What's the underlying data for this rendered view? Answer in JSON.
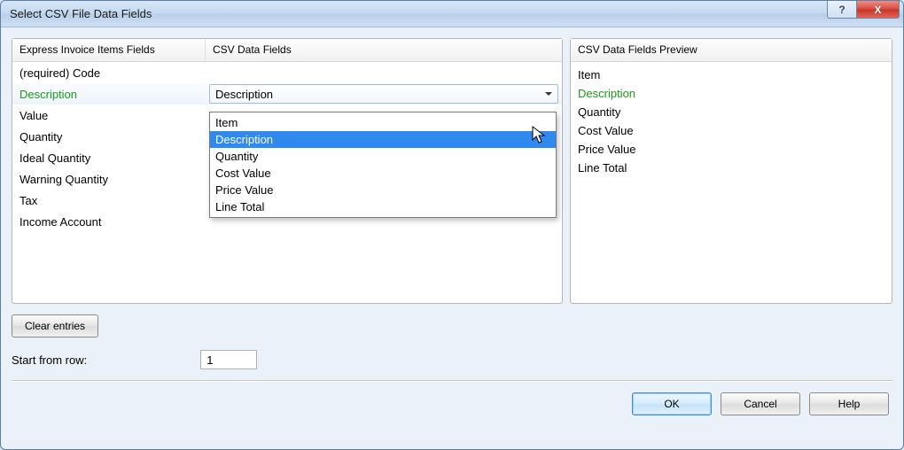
{
  "window": {
    "title": "Select CSV File Data Fields",
    "help_glyph": "?",
    "close_glyph": "X"
  },
  "left_panel": {
    "col1_header": "Express Invoice Items Fields",
    "col2_header": "CSV Data Fields",
    "rows": [
      {
        "field": "(required) Code",
        "mapped": ""
      },
      {
        "field": "Description",
        "mapped": "Description",
        "selected": true
      },
      {
        "field": "Value",
        "mapped": ""
      },
      {
        "field": "Quantity",
        "mapped": ""
      },
      {
        "field": "Ideal Quantity",
        "mapped": ""
      },
      {
        "field": "Warning Quantity",
        "mapped": ""
      },
      {
        "field": "Tax",
        "mapped": ""
      },
      {
        "field": "Income Account",
        "mapped": ""
      }
    ]
  },
  "dropdown": {
    "highlighted_index": 1,
    "options": [
      "Item",
      "Description",
      "Quantity",
      "Cost Value",
      "Price Value",
      "Line Total"
    ]
  },
  "preview_panel": {
    "header": "CSV Data Fields Preview",
    "match_index": 1,
    "items": [
      "Item",
      "Description",
      "Quantity",
      "Cost Value",
      "Price Value",
      "Line Total"
    ]
  },
  "controls": {
    "clear_entries": "Clear entries",
    "start_row_label": "Start from row:",
    "start_row_value": "1"
  },
  "footer": {
    "ok": "OK",
    "cancel": "Cancel",
    "help": "Help"
  }
}
